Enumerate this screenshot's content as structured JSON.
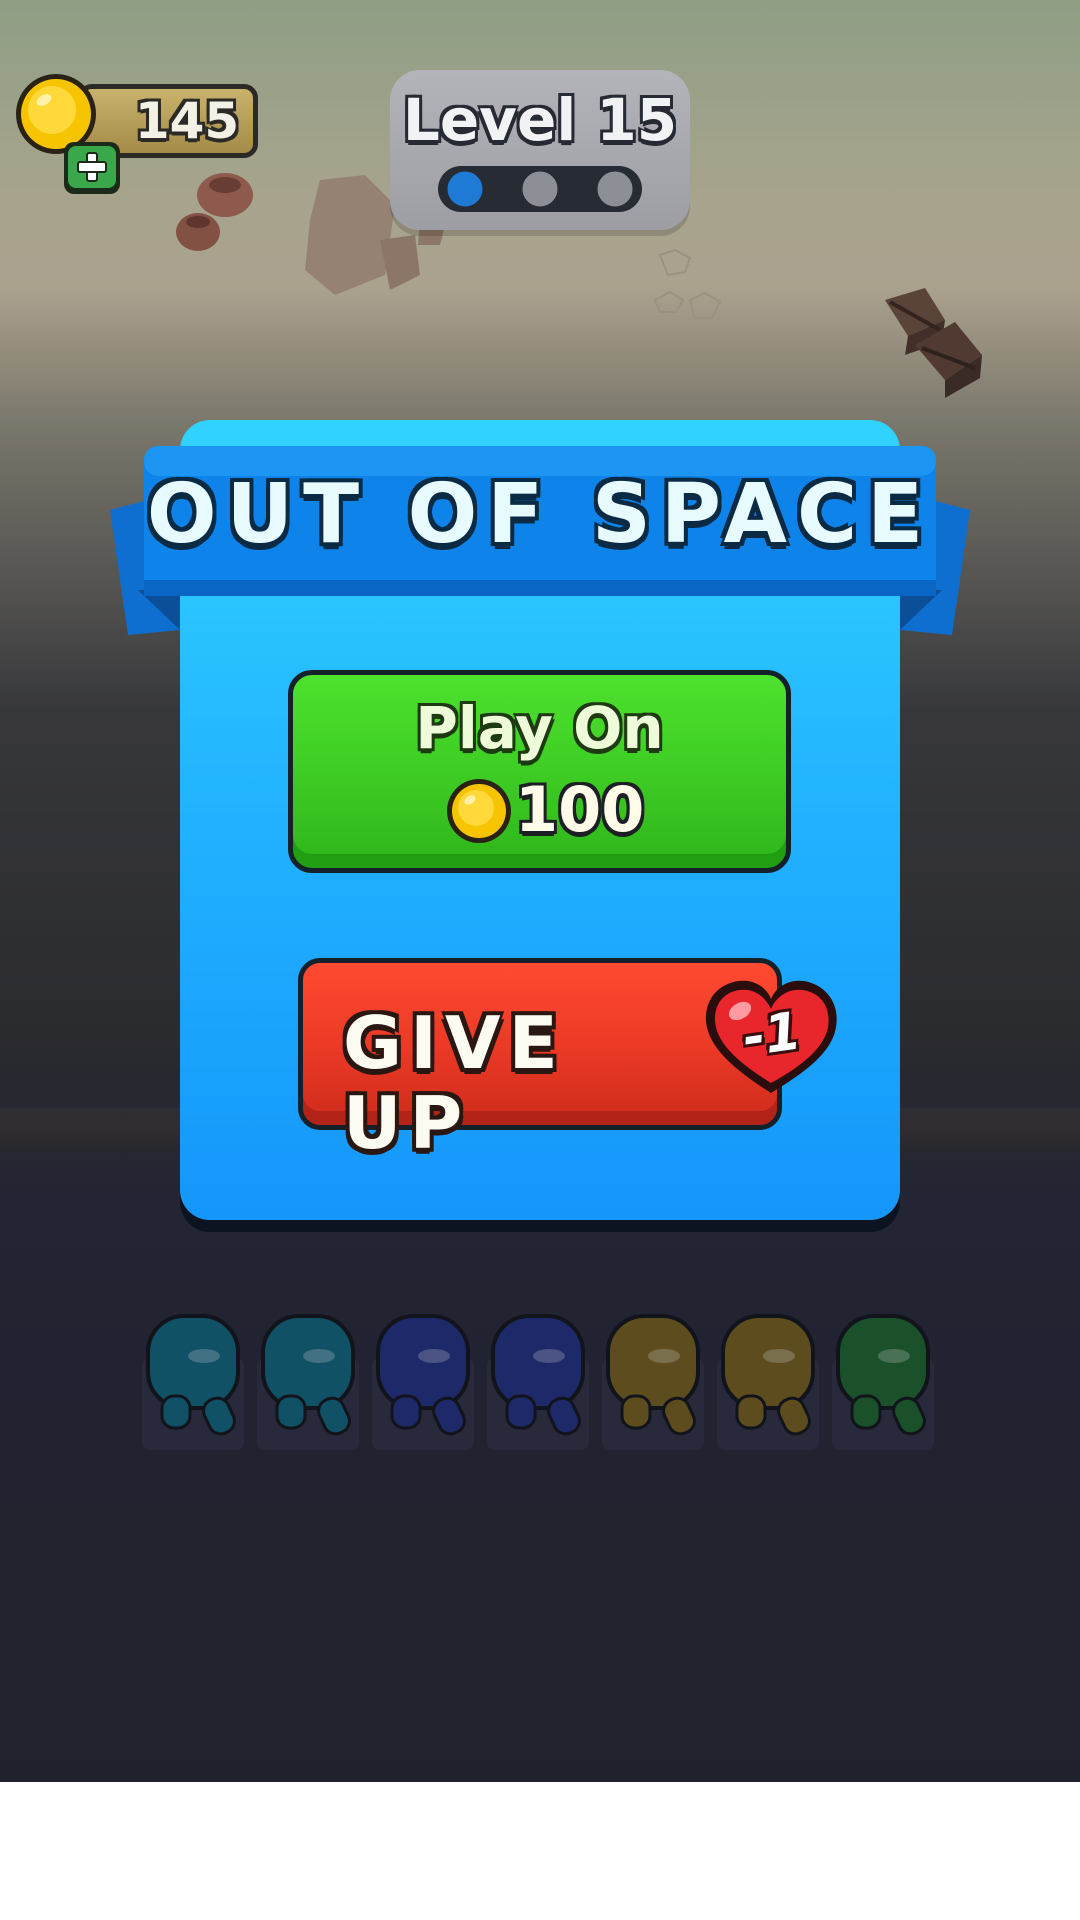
{
  "hud": {
    "coins": "145",
    "level_title": "Level 15",
    "level_progress": {
      "stages_total": 3,
      "stages_completed": 1
    }
  },
  "popup": {
    "title": "OUT OF SPACE",
    "play_on": {
      "label": "Play On",
      "cost": "100"
    },
    "give_up": {
      "label": "GIVE UP",
      "life_cost": "-1"
    }
  },
  "colors": {
    "popup_blue": "#21b2ff",
    "play_green": "#3fcf25",
    "give_up_red": "#ec3a26",
    "coin_gold": "#f5c300"
  },
  "characters": {
    "colors": [
      "#0f5e77",
      "#0f5e77",
      "#1f2e7a",
      "#1f2e7a",
      "#6d5a1f",
      "#6d5a1f",
      "#1b5e2e"
    ]
  }
}
